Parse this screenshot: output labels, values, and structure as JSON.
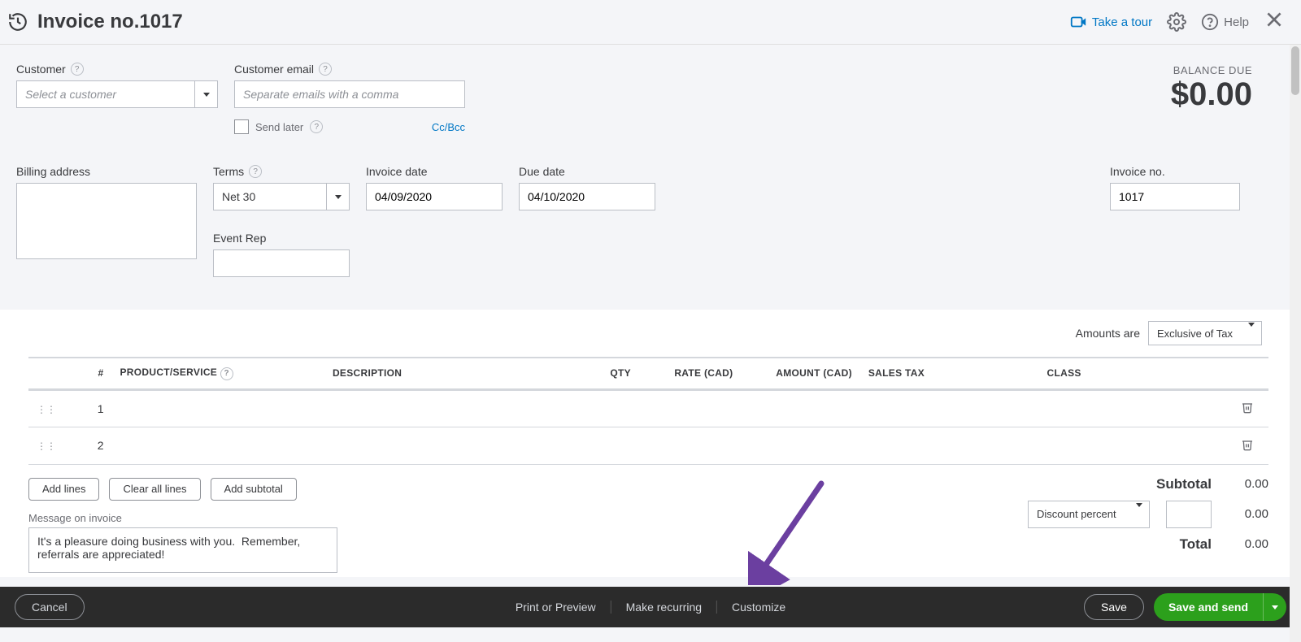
{
  "header": {
    "title": "Invoice no.1017",
    "tour": "Take a tour",
    "help": "Help"
  },
  "customer": {
    "label": "Customer",
    "placeholder": "Select a customer"
  },
  "email": {
    "label": "Customer email",
    "placeholder": "Separate emails with a comma",
    "send_later": "Send later",
    "ccbcc": "Cc/Bcc"
  },
  "balance": {
    "label": "BALANCE DUE",
    "amount": "$0.00"
  },
  "billing": {
    "label": "Billing address"
  },
  "terms": {
    "label": "Terms",
    "value": "Net 30"
  },
  "invoice_date": {
    "label": "Invoice date",
    "value": "04/09/2020"
  },
  "due_date": {
    "label": "Due date",
    "value": "04/10/2020"
  },
  "invoice_no": {
    "label": "Invoice no.",
    "value": "1017"
  },
  "event_rep": {
    "label": "Event Rep"
  },
  "amounts_are": {
    "label": "Amounts are",
    "value": "Exclusive of Tax"
  },
  "table": {
    "cols": {
      "num": "#",
      "product": "PRODUCT/SERVICE",
      "desc": "DESCRIPTION",
      "qty": "QTY",
      "rate": "RATE (CAD)",
      "amount": "AMOUNT (CAD)",
      "tax": "SALES TAX",
      "class": "CLASS"
    },
    "rows": [
      {
        "num": "1"
      },
      {
        "num": "2"
      }
    ],
    "add_lines": "Add lines",
    "clear_lines": "Clear all lines",
    "add_subtotal": "Add subtotal"
  },
  "message": {
    "label": "Message on invoice",
    "value": "It's a pleasure doing business with you.  Remember, referrals are appreciated!"
  },
  "totals": {
    "subtotal_label": "Subtotal",
    "subtotal_value": "0.00",
    "discount_label": "Discount percent",
    "discount_value": "0.00",
    "total_label": "Total",
    "total_value": "0.00"
  },
  "footer": {
    "cancel": "Cancel",
    "print": "Print or Preview",
    "recurring": "Make recurring",
    "customize": "Customize",
    "save": "Save",
    "save_send": "Save and send"
  }
}
